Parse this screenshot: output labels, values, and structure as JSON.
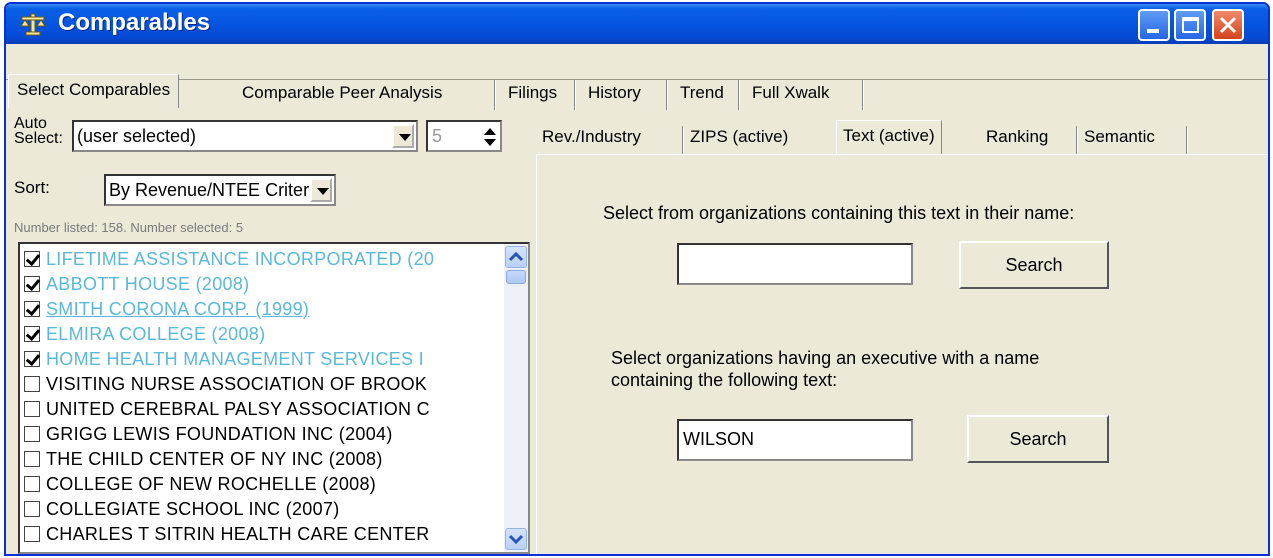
{
  "window": {
    "title": "Comparables",
    "icon": "scales-icon",
    "accent_color": "#0554e0"
  },
  "main_tabs": [
    "Select Comparables",
    "Comparable Peer Analysis",
    "Filings",
    "History",
    "Trend",
    "Full Xwalk"
  ],
  "left": {
    "auto_select_label_line1": "Auto",
    "auto_select_label_line2": "Select:",
    "auto_select_value": "(user selected)",
    "spin_value": "5",
    "sort_label": "Sort:",
    "sort_value": "By Revenue/NTEE Criteria",
    "status": "Number listed: 158. Number selected: 5",
    "items": [
      {
        "label": "LIFETIME ASSISTANCE INCORPORATED (20",
        "checked": true
      },
      {
        "label": "ABBOTT HOUSE (2008)",
        "checked": true
      },
      {
        "label": "SMITH CORONA CORP. (1999)",
        "checked": true
      },
      {
        "label": "ELMIRA COLLEGE (2008)",
        "checked": true
      },
      {
        "label": "HOME HEALTH MANAGEMENT SERVICES I",
        "checked": true
      },
      {
        "label": "VISITING NURSE ASSOCIATION OF BROOK",
        "checked": false
      },
      {
        "label": "UNITED CEREBRAL PALSY ASSOCIATION C",
        "checked": false
      },
      {
        "label": "GRIGG LEWIS FOUNDATION INC (2004)",
        "checked": false
      },
      {
        "label": "THE CHILD CENTER OF NY INC (2008)",
        "checked": false
      },
      {
        "label": "COLLEGE OF NEW ROCHELLE (2008)",
        "checked": false
      },
      {
        "label": "COLLEGIATE SCHOOL INC (2007)",
        "checked": false
      },
      {
        "label": "CHARLES T SITRIN HEALTH CARE CENTER",
        "checked": false
      }
    ],
    "checked_color": "#5bb8d8"
  },
  "right": {
    "tabs": [
      "Rev./Industry",
      "ZIPS (active)",
      "Text (active)",
      "Ranking",
      "Semantic"
    ],
    "org_text_label": "Select from organizations containing this text in their name:",
    "org_text_value": "",
    "search_label": "Search",
    "exec_label_line1": "Select organizations having an executive with a name",
    "exec_label_line2": "containing the following text:",
    "exec_text_value": "WILSON",
    "search2_label": "Search"
  }
}
